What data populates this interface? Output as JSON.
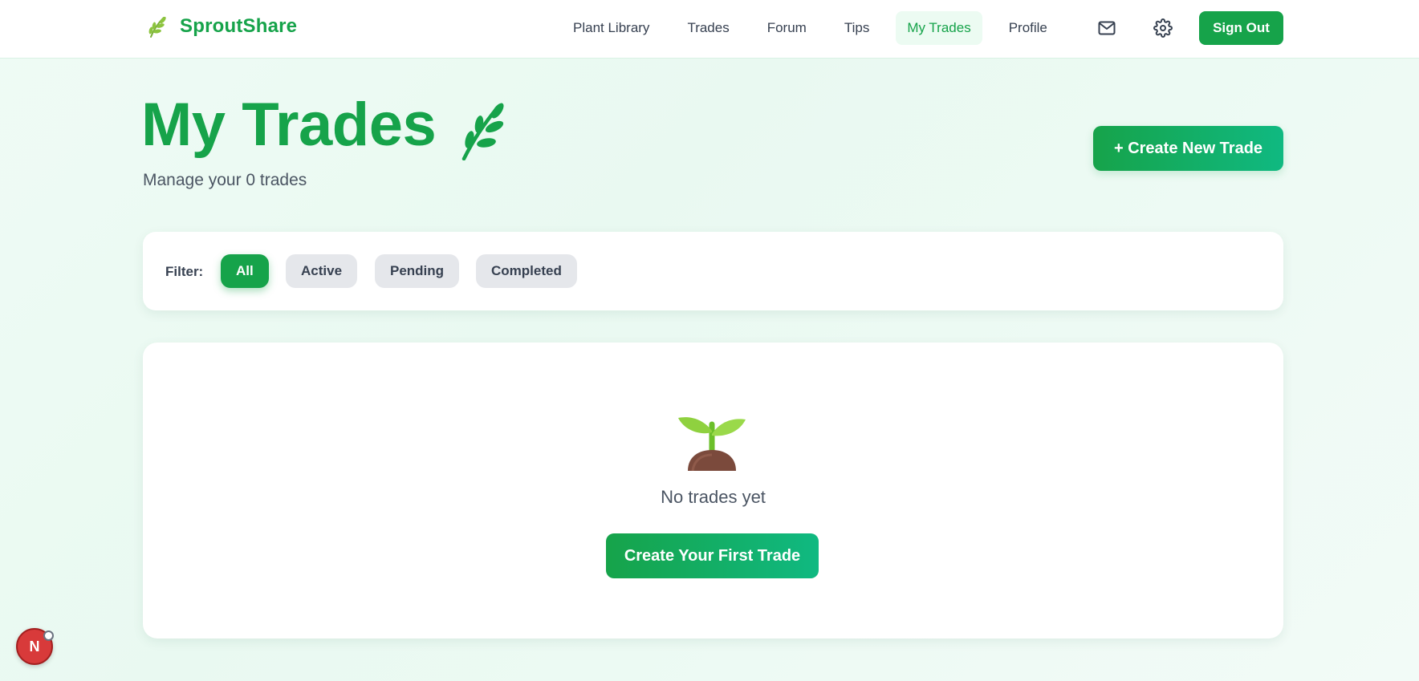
{
  "brand": {
    "name": "SproutShare",
    "icon": "herb-icon"
  },
  "nav": {
    "links": [
      {
        "label": "Plant Library",
        "active": false
      },
      {
        "label": "Trades",
        "active": false
      },
      {
        "label": "Forum",
        "active": false
      },
      {
        "label": "Tips",
        "active": false
      },
      {
        "label": "My Trades",
        "active": true
      },
      {
        "label": "Profile",
        "active": false
      }
    ],
    "mail_icon": "mail-icon",
    "settings_icon": "gear-icon",
    "signout_label": "Sign Out"
  },
  "header": {
    "title": "My Trades",
    "title_icon": "herb-icon",
    "subtitle": "Manage your 0 trades",
    "create_label": "+ Create New Trade"
  },
  "filter": {
    "label": "Filter:",
    "options": [
      "All",
      "Active",
      "Pending",
      "Completed"
    ],
    "selected": "All"
  },
  "empty": {
    "icon": "seedling-icon",
    "message": "No trades yet",
    "cta_label": "Create Your First Trade"
  },
  "dev_badge": {
    "label": "N"
  },
  "colors": {
    "accent": "#16a34a",
    "accent_light": "#10b981",
    "active_nav_bg": "#ecfbf2",
    "chip_bg": "#e5e7eb"
  }
}
